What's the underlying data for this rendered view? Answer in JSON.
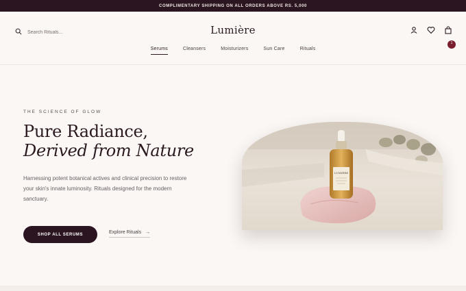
{
  "announcement": "COMPLIMENTARY SHIPPING ON ALL ORDERS ABOVE RS. 5,000",
  "header": {
    "search_placeholder": "Search Rituals...",
    "logo": "Lumière",
    "cart_count": "1",
    "nav": [
      "Serums",
      "Cleansers",
      "Moisturizers",
      "Sun Care",
      "Rituals"
    ],
    "active_nav": "Serums"
  },
  "hero": {
    "eyebrow": "THE SCIENCE OF GLOW",
    "title_line1": "Pure Radiance,",
    "title_line2": "Derived from Nature",
    "description": "Harnessing potent botanical actives and clinical precision to restore your skin's innate luminosity. Rituals designed for the modern sanctuary.",
    "primary_cta": "SHOP ALL SERUMS",
    "secondary_cta": "Explore Rituals",
    "secondary_arrow": "→",
    "bottle_label": "LUMIERE"
  },
  "icons": {
    "search": "search-icon",
    "account": "user-icon",
    "wishlist": "heart-icon",
    "cart": "bag-icon"
  },
  "colors": {
    "accent": "#2a1520",
    "background": "#faf7f4",
    "badge": "#7a1f2e"
  }
}
